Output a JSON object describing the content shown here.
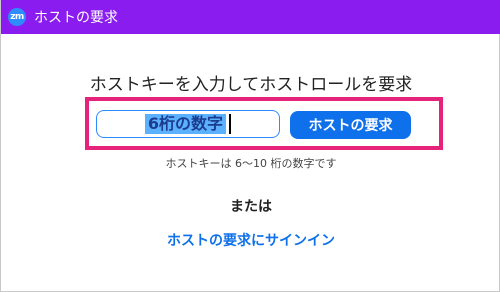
{
  "window": {
    "title": "ホストの要求",
    "icon_text": "zm",
    "titlebar_color": "#8a1cf0"
  },
  "main": {
    "heading": "ホストキーを入力してホストロールを要求",
    "host_key_input": {
      "value": "",
      "placeholder": "6桁の数字",
      "selected_text": "6桁の数字"
    },
    "request_button_label": "ホストの要求",
    "hint": "ホストキーは 6～10 桁の数字です",
    "or_label": "または",
    "signin_link_label": "ホストの要求にサインイン"
  },
  "colors": {
    "accent": "#0e71eb",
    "highlight_frame": "#e5237a"
  }
}
